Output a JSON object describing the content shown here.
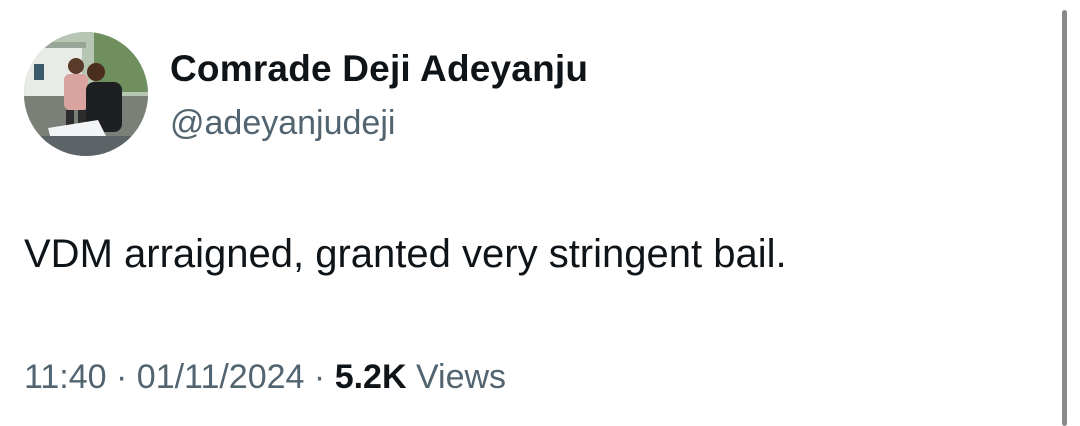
{
  "author": {
    "display_name": "Comrade Deji Adeyanju",
    "handle": "@adeyanjudeji",
    "avatar_icon": "profile-photo-avatar"
  },
  "tweet": {
    "text": "VDM arraigned, granted very stringent bail.",
    "time": "11:40",
    "date": "01/11/2024",
    "separator": "·",
    "views_count": "5.2K",
    "views_label": "Views"
  },
  "colors": {
    "text_primary": "#0f1419",
    "text_secondary": "#536471",
    "background": "#ffffff",
    "scrollbar": "#8a8a8a"
  }
}
